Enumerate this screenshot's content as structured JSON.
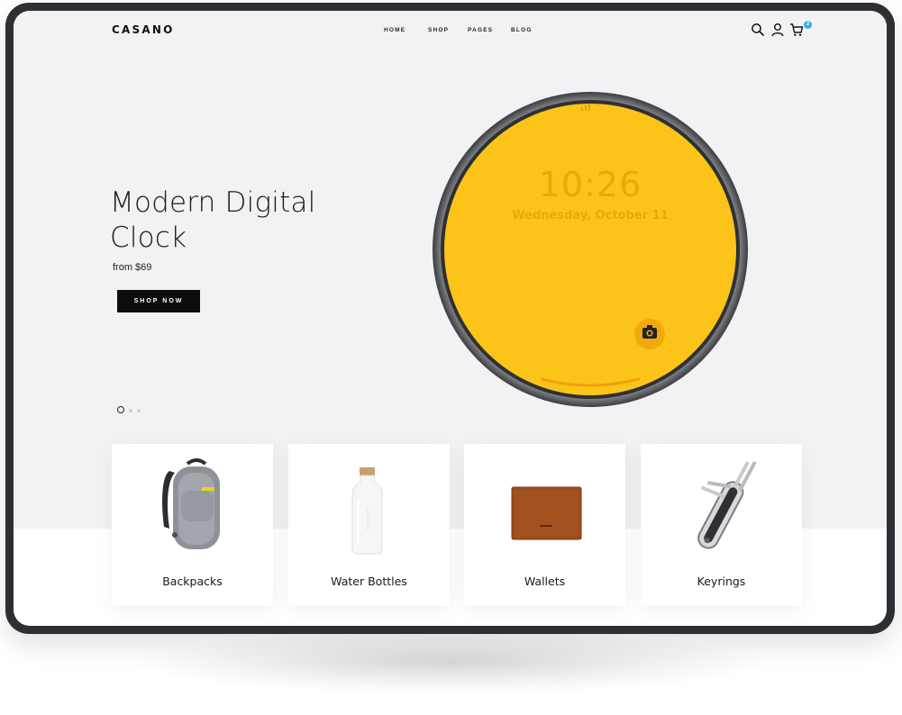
{
  "header": {
    "logo": "CASANO",
    "nav": [
      "HOME",
      "SHOP",
      "PAGES",
      "BLOG"
    ],
    "icons": [
      "search-icon",
      "user-icon",
      "cart-icon"
    ],
    "cart_count": "2"
  },
  "hero": {
    "title_line1": "Modern Digital",
    "title_line2": "Clock",
    "price": "from $69",
    "button": "SHOP NOW",
    "clock_time": "10:26",
    "clock_date": "Wednesday, October 11",
    "slide_count": 3,
    "active_slide": 1
  },
  "categories": [
    {
      "label": "Backpacks"
    },
    {
      "label": "Water Bottles"
    },
    {
      "label": "Wallets"
    },
    {
      "label": "Keyrings"
    }
  ],
  "colors": {
    "accent": "#2bb6e8",
    "clock_face": "#fcc419",
    "clock_text": "#e5ab07",
    "hero_bg": "#f2f2f4",
    "button_bg": "#0d0d0d"
  }
}
